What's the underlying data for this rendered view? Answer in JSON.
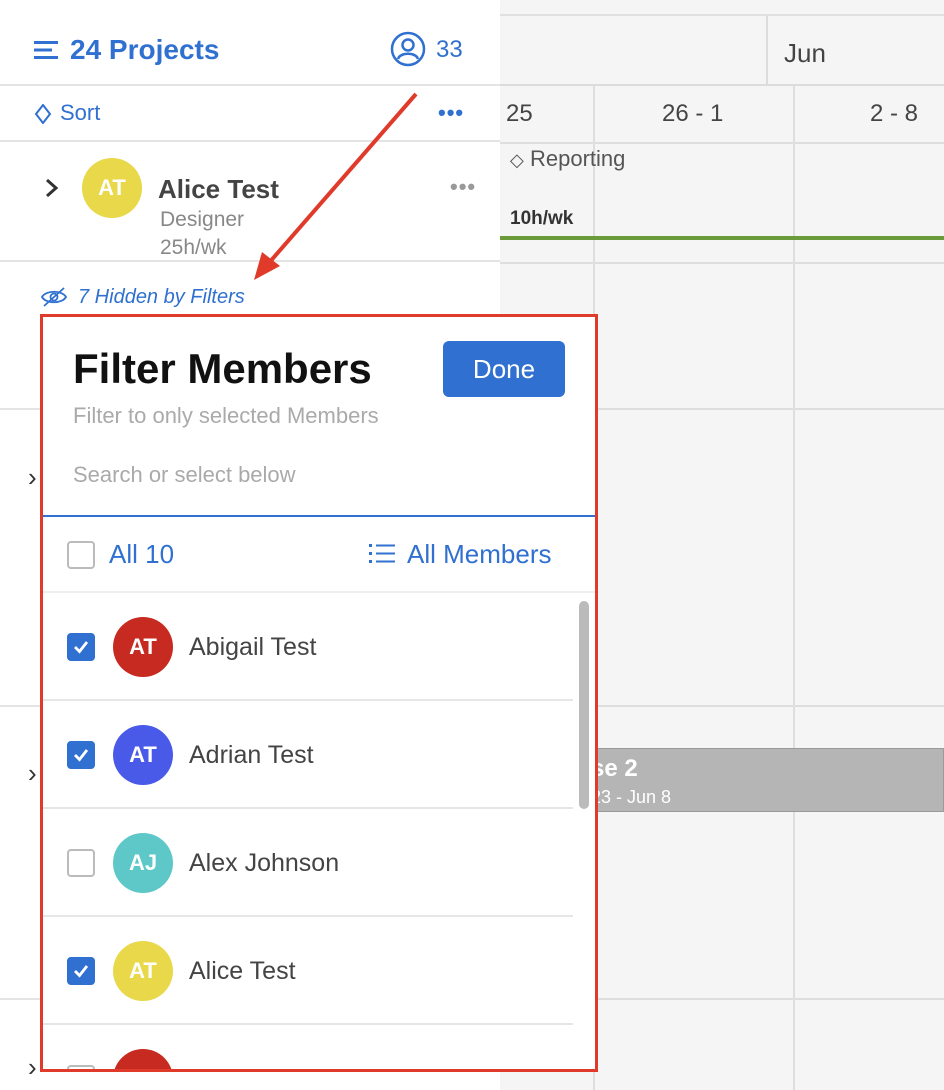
{
  "header": {
    "title": "24 Projects",
    "member_count": "33"
  },
  "toolbar": {
    "sort_label": "Sort",
    "more_label": "•••"
  },
  "member_row": {
    "initials": "AT",
    "name": "Alice Test",
    "role": "Designer",
    "hours": "25h/wk",
    "more_label": "•••",
    "avatar_color": "#e8d84a"
  },
  "hidden_filter": {
    "label": "7 Hidden by Filters"
  },
  "timeline": {
    "month": "Jun",
    "weeks": [
      "25",
      "26 - 1",
      "2 - 8"
    ],
    "task_label": "Reporting",
    "task_hours": "10h/wk",
    "phase_name": "se 2",
    "phase_dates": "23 - Jun 8"
  },
  "filter_popover": {
    "title": "Filter Members",
    "done_label": "Done",
    "subtitle": "Filter to only selected Members",
    "search_placeholder": "Search or select below",
    "all_label": "All 10",
    "all_members_label": "All Members",
    "members": [
      {
        "initials": "AT",
        "name": "Abigail Test",
        "checked": true,
        "color": "#c62a20"
      },
      {
        "initials": "AT",
        "name": "Adrian Test",
        "checked": true,
        "color": "#4a5ae8"
      },
      {
        "initials": "AJ",
        "name": "Alex Johnson",
        "checked": false,
        "color": "#5ec8c8"
      },
      {
        "initials": "AT",
        "name": "Alice Test",
        "checked": true,
        "color": "#e8d84a"
      },
      {
        "initials": "",
        "name": "",
        "checked": false,
        "color": "#c62a20"
      }
    ]
  },
  "colors": {
    "accent": "#2f70d0",
    "annotation": "#e03a2a",
    "progress_green": "#6a9a3a"
  }
}
